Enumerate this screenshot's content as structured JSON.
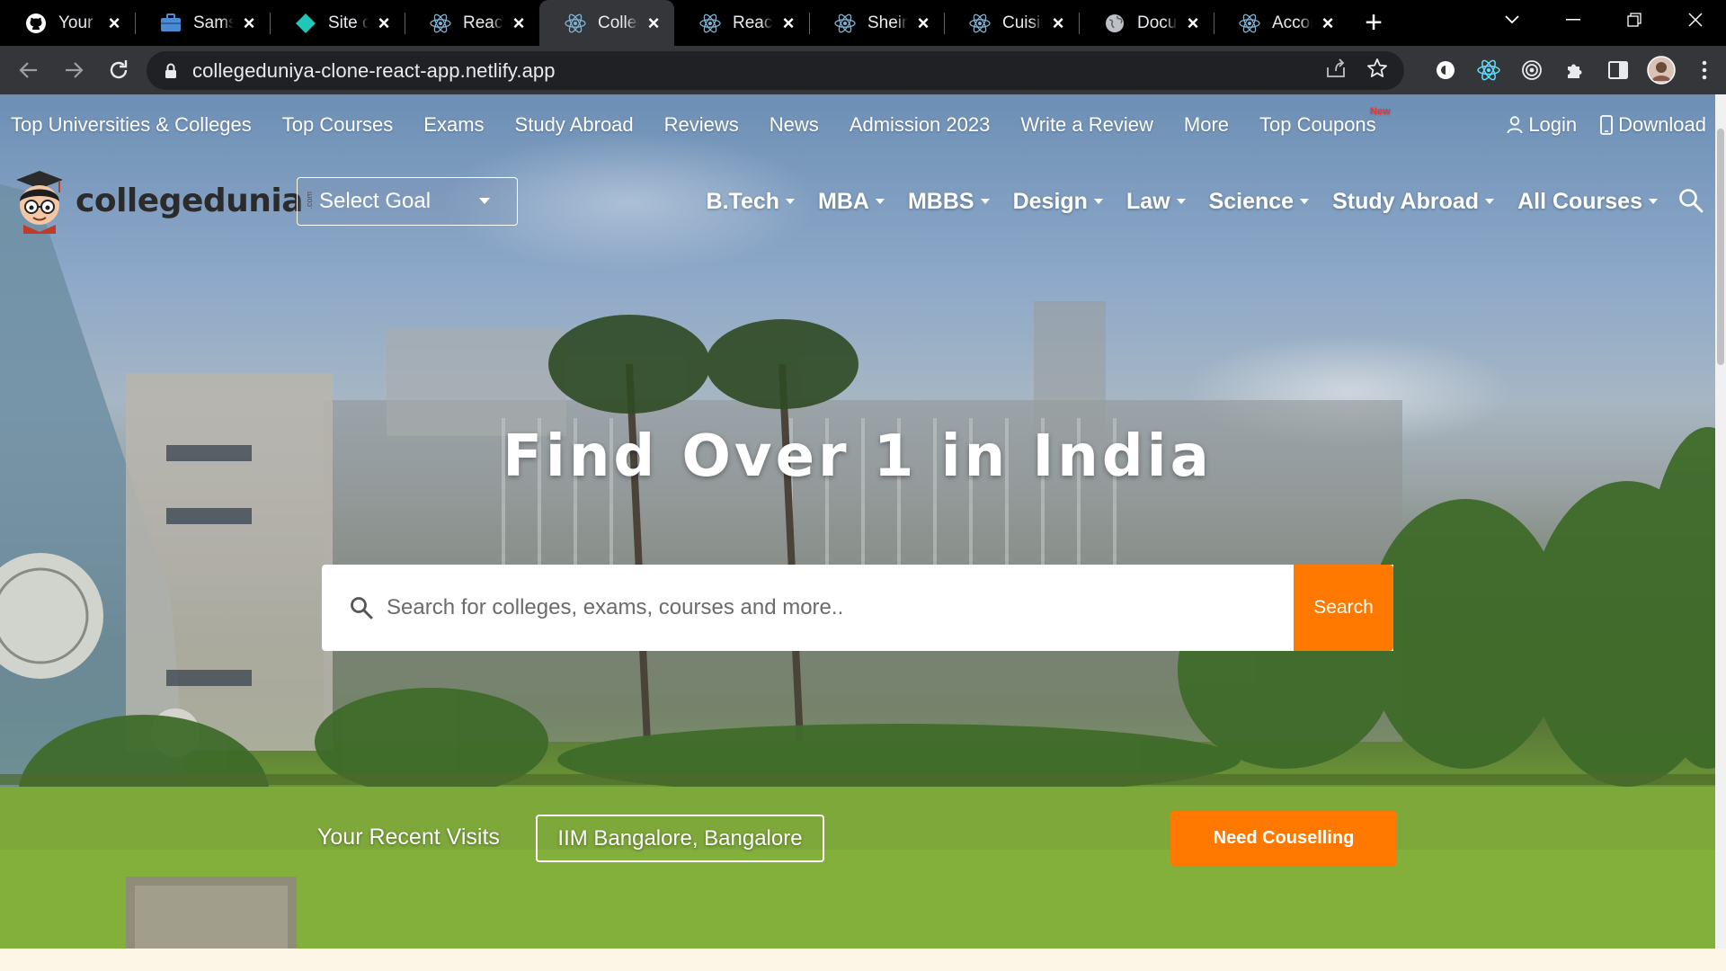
{
  "browser": {
    "tabs": [
      {
        "title": "Your Repositories",
        "icon": "github-icon"
      },
      {
        "title": "Samsh...",
        "icon": "briefcase-icon"
      },
      {
        "title": "Site overview",
        "icon": "netlify-icon"
      },
      {
        "title": "React App",
        "icon": "react-icon"
      },
      {
        "title": "Collegedunia",
        "icon": "react-icon"
      },
      {
        "title": "React App",
        "icon": "react-icon"
      },
      {
        "title": "Shein Clone",
        "icon": "react-icon"
      },
      {
        "title": "Cuisine",
        "icon": "react-icon"
      },
      {
        "title": "Documentation",
        "icon": "globe-icon"
      },
      {
        "title": "Accordion",
        "icon": "react-icon"
      }
    ],
    "active_tab_index": 4,
    "url": "collegeduniya-clone-react-app.netlify.app"
  },
  "site": {
    "topnav": {
      "items": [
        "Top Universities & Colleges",
        "Top Courses",
        "Exams",
        "Study Abroad",
        "Reviews",
        "News",
        "Admission 2023",
        "Write a Review",
        "More",
        "Top Coupons"
      ],
      "badge": "New",
      "login": "Login",
      "download": "Download"
    },
    "logo": {
      "brand": "collegedunia",
      "suffix": ".com"
    },
    "select_goal": "Select Goal",
    "mainnav": [
      "B.Tech",
      "MBA",
      "MBBS",
      "Design",
      "Law",
      "Science",
      "Study Abroad",
      "All Courses"
    ],
    "hero": {
      "title": "Find Over 1 in India",
      "search_placeholder": "Search for colleges, exams, courses and more..",
      "search_button": "Search",
      "recent_label": "Your Recent Visits",
      "recent_item": "IIM Bangalore, Bangalore",
      "counselling_button": "Need Couselling"
    },
    "colors": {
      "accent": "#ff7900",
      "badge": "#ff2d2d"
    }
  }
}
